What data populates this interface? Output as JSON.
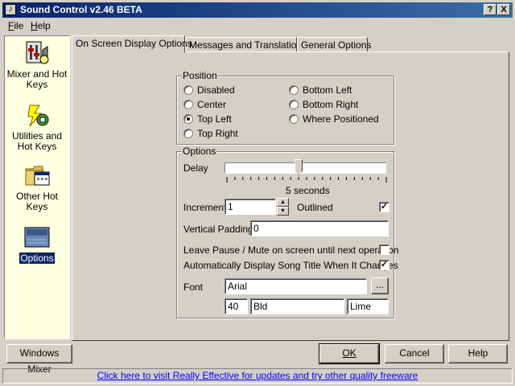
{
  "window": {
    "title": "Sound Control v2.46 BETA",
    "help_glyph": "?",
    "close_glyph": "X",
    "app_icon_glyph": "♪"
  },
  "menu": {
    "file": {
      "accel": "F",
      "rest": "ile"
    },
    "help": {
      "accel": "H",
      "rest": "elp"
    }
  },
  "sidebar": {
    "items": [
      {
        "label": "Mixer and Hot Keys",
        "icon": "mixer-icon"
      },
      {
        "label": "Utilities and Hot Keys",
        "icon": "utilities-icon"
      },
      {
        "label": "Other Hot Keys",
        "icon": "folder-icon"
      },
      {
        "label": "Options",
        "icon": "options-icon",
        "selected": true
      }
    ]
  },
  "tabs": [
    {
      "label": "On Screen Display Options",
      "active": true
    },
    {
      "label": "Messages and Translations",
      "active": false
    },
    {
      "label": "General Options",
      "active": false
    }
  ],
  "position": {
    "title": "Position",
    "options": [
      {
        "label": "Disabled",
        "accel": "D",
        "checked": false
      },
      {
        "label": "Center",
        "accel": "C",
        "checked": false
      },
      {
        "label": "Top Left",
        "accel": "L",
        "checked": true
      },
      {
        "label": "Top Right",
        "accel": "R",
        "checked": false
      },
      {
        "label": "Bottom Left",
        "accel": "e",
        "checked": false
      },
      {
        "label": "Bottom Right",
        "accel": "R",
        "checked": false
      },
      {
        "label": "Where Positioned",
        "accel": "W",
        "checked": false
      }
    ]
  },
  "options": {
    "title": "Options",
    "delay_label": "Delay",
    "delay_value": "5 seconds",
    "delay_fraction": 0.46,
    "tick_count": 21,
    "increment_label": "Increment",
    "increment_value": "1",
    "outlined_label": "Outlined",
    "outlined_checked": true,
    "vertical_padding_label": "Vertical Padding",
    "vertical_padding_value": "0",
    "leave_pause_label": "Leave Pause / Mute on screen until next operation",
    "leave_pause_checked": false,
    "auto_display_label": "Automatically Display Song Title When It Changes",
    "auto_display_checked": true,
    "font_label": "Font",
    "font_name": "Arial",
    "font_browse": "...",
    "font_size": "40",
    "font_style": "Bld",
    "font_color": "Lime"
  },
  "buttons": {
    "windows_mixer": "Windows Mixer",
    "ok": "OK",
    "cancel": "Cancel",
    "help": "Help"
  },
  "status": {
    "link": "Click here to visit Really Effective for updates and try other quality freeware"
  },
  "colors": {
    "face": "#d4d0c8",
    "title_start": "#0a246a",
    "title_end": "#3a6ea5",
    "sidebar_bg": "#ffffe1",
    "link": "#0000ff"
  }
}
